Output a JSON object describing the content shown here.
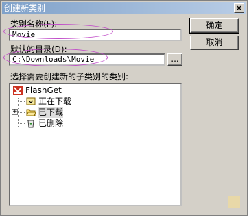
{
  "window": {
    "title": "创建新类别",
    "close_label": "×"
  },
  "category_name": {
    "label": "类别名称(F):",
    "value": "Movie"
  },
  "default_dir": {
    "label": "默认的目录(D):",
    "value": "C:\\Downloads\\Movie",
    "browse_label": "..."
  },
  "buttons": {
    "ok": "确定",
    "cancel": "取消"
  },
  "tree": {
    "label": "选择需要创建新的子类别的类别:",
    "items": [
      {
        "label": "FlashGet",
        "icon": "flashget-icon"
      },
      {
        "label": "正在下载",
        "icon": "downloading-icon"
      },
      {
        "label": "已下载",
        "icon": "folder-open-icon",
        "expander": "+"
      },
      {
        "label": "已删除",
        "icon": "recycle-bin-icon"
      }
    ]
  },
  "colors": {
    "dialog_bg": "#d4d0c8",
    "titlebar_start": "#7fa1c9",
    "titlebar_end": "#b9cde6",
    "annotation": "#c04cc8"
  }
}
